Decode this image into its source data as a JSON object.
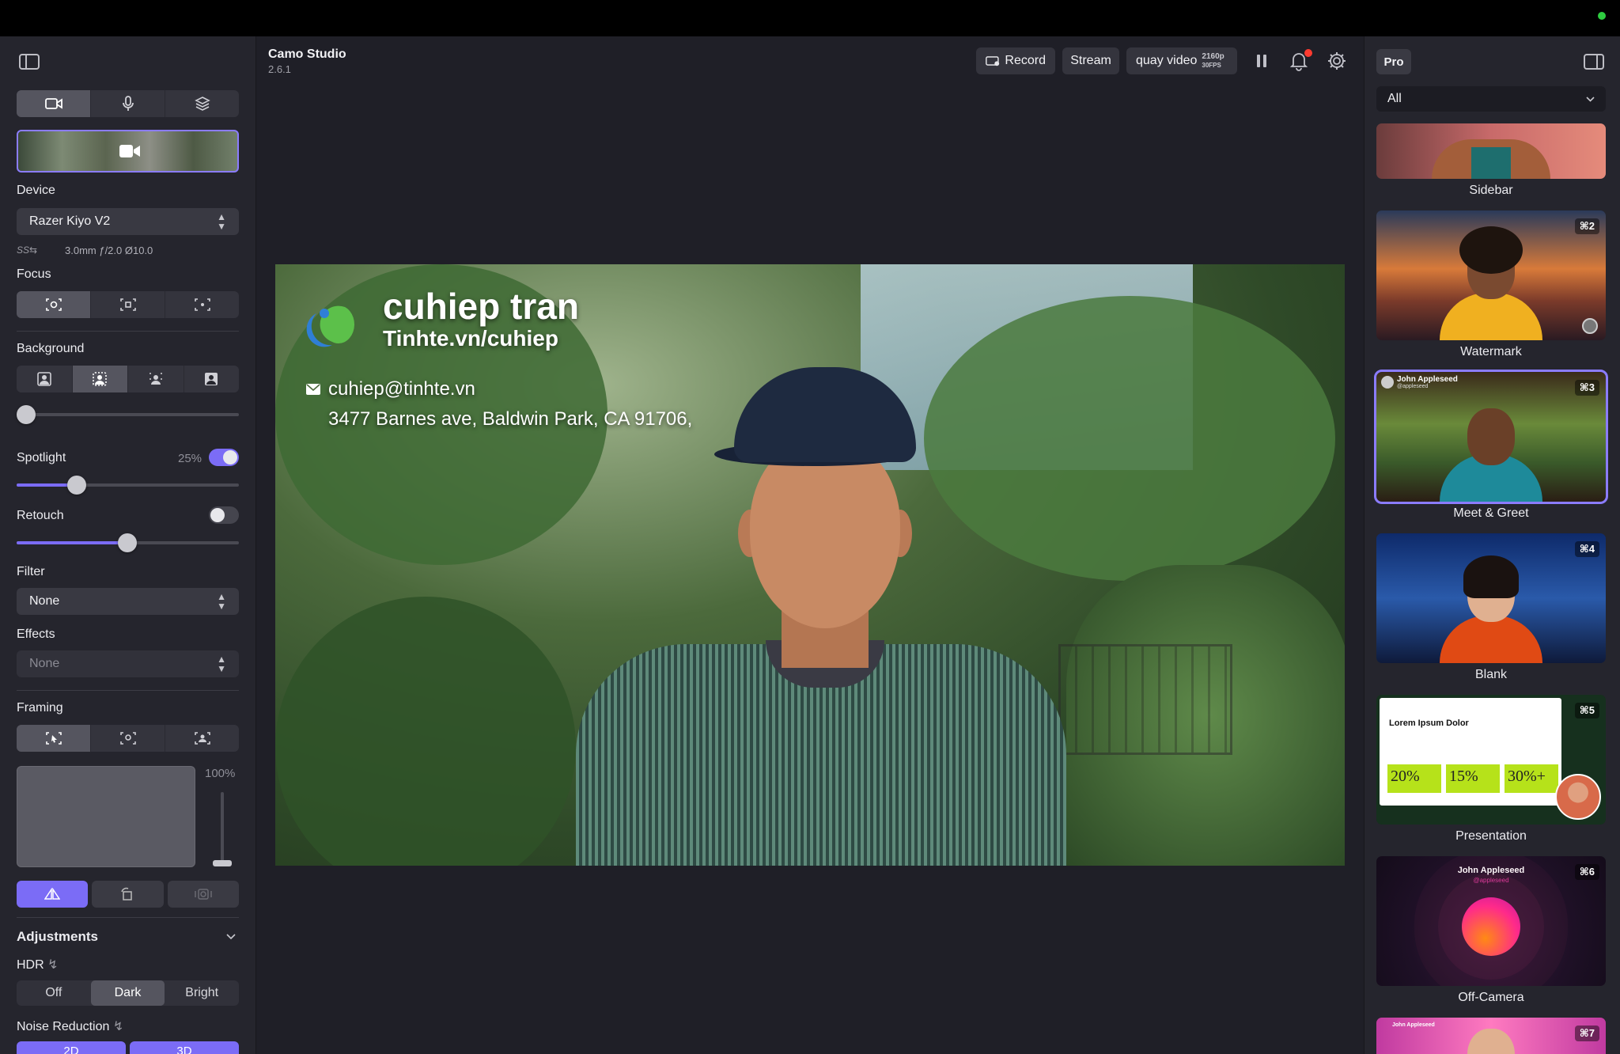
{
  "app": {
    "name": "Camo Studio",
    "version": "2.6.1"
  },
  "left_panel": {
    "device_label": "Device",
    "device_value": "Razer Kiyo V2",
    "lens_info": "3.0mm ƒ/2.0 Ø10.0",
    "usb_label": "SS⇆",
    "focus_label": "Focus",
    "background_label": "Background",
    "spotlight_label": "Spotlight",
    "spotlight_value": "25%",
    "spotlight_enabled": true,
    "retouch_label": "Retouch",
    "retouch_enabled": false,
    "filter_label": "Filter",
    "filter_value": "None",
    "effects_label": "Effects",
    "effects_value": "None",
    "framing_label": "Framing",
    "zoom_value": "100%",
    "adjustments_label": "Adjustments",
    "hdr_label": "HDR",
    "hdr_options": [
      "Off",
      "Dark",
      "Bright"
    ],
    "hdr_selected": "Dark",
    "noise_label": "Noise Reduction",
    "noise_options": [
      "2D",
      "3D"
    ]
  },
  "toolbar": {
    "record_label": "Record",
    "stream_label": "Stream",
    "source_label": "quay video",
    "resolution": "2160p",
    "fps": "30FPS"
  },
  "overlay": {
    "name": "cuhiep tran",
    "site": "Tinhte.vn/cuhiep",
    "email": "cuhiep@tinhte.vn",
    "address": "3477 Barnes ave, Baldwin Park, CA 91706,"
  },
  "right_panel": {
    "plan_badge": "Pro",
    "filter_value": "All",
    "cards": [
      {
        "name": "Sidebar",
        "shortcut": ""
      },
      {
        "name": "Watermark",
        "shortcut": "⌘2"
      },
      {
        "name": "Meet & Greet",
        "shortcut": "⌘3",
        "person": "John Appleseed",
        "handle": "@appleseed"
      },
      {
        "name": "Blank",
        "shortcut": "⌘4"
      },
      {
        "name": "Presentation",
        "shortcut": "⌘5",
        "title": "Lorem Ipsum Dolor",
        "stats": [
          "20%",
          "15%",
          "30%+"
        ]
      },
      {
        "name": "Off-Camera",
        "shortcut": "⌘6",
        "person": "John Appleseed",
        "handle": "@appleseed"
      },
      {
        "name": "",
        "shortcut": "⌘7",
        "person": "John Appleseed"
      }
    ]
  },
  "colors": {
    "accent": "#7b6cf6",
    "selection": "#8b7cff",
    "badge": "#ff3b30"
  }
}
